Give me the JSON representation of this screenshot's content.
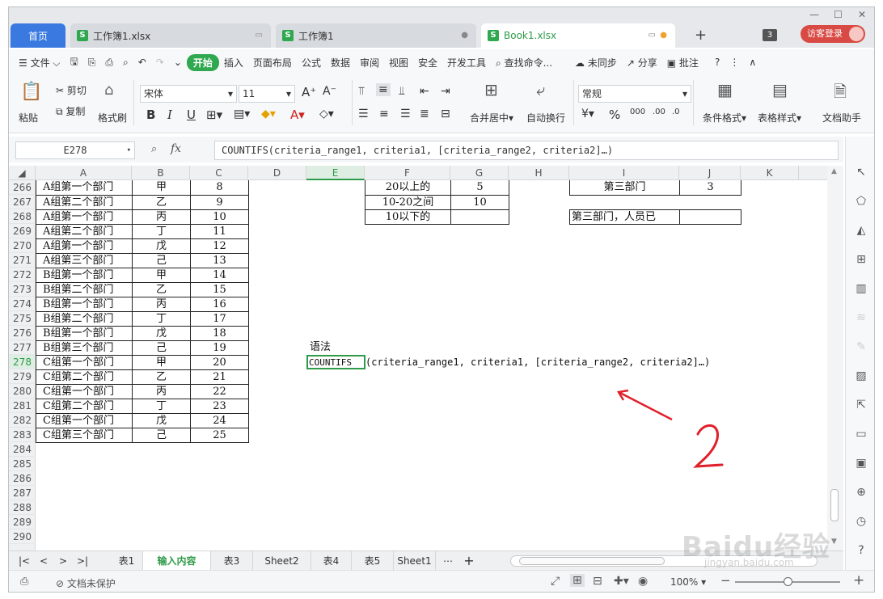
{
  "tabs": {
    "home": "首页",
    "tab1": "工作簿1.xlsx",
    "tab2": "工作簿1",
    "tab3": "Book1.xlsx",
    "count": "3",
    "login": "访客登录"
  },
  "menu": {
    "file": "文件",
    "items": [
      "开始",
      "插入",
      "页面布局",
      "公式",
      "数据",
      "审阅",
      "视图",
      "安全",
      "开发工具"
    ],
    "search": "查找命令...",
    "sync": "未同步",
    "share": "分享",
    "comment": "批注"
  },
  "ribbon": {
    "paste": "粘贴",
    "cut": "剪切",
    "copy": "复制",
    "format_painter": "格式刷",
    "font": "宋体",
    "size": "11",
    "merge": "合并居中",
    "wrap": "自动换行",
    "number_format": "常规",
    "cond_format": "条件格式",
    "table_style": "表格样式",
    "doc_helper": "文档助手"
  },
  "formula": {
    "namebox": "E278",
    "fx": "fx",
    "content": "COUNTIFS(criteria_range1, criteria1, [criteria_range2, criteria2]…)"
  },
  "columns": [
    "A",
    "B",
    "C",
    "D",
    "E",
    "F",
    "G",
    "H",
    "I",
    "J",
    "K"
  ],
  "rows": [
    "266",
    "267",
    "268",
    "269",
    "270",
    "271",
    "272",
    "273",
    "274",
    "275",
    "276",
    "277",
    "278",
    "279",
    "280",
    "281",
    "282",
    "283",
    "284",
    "285",
    "286",
    "287",
    "288",
    "289",
    "290"
  ],
  "table_a": [
    [
      "A组第一个部门",
      "甲",
      "8"
    ],
    [
      "A组第二个部门",
      "乙",
      "9"
    ],
    [
      "A组第一个部门",
      "丙",
      "10"
    ],
    [
      "A组第二个部门",
      "丁",
      "11"
    ],
    [
      "A组第一个部门",
      "戊",
      "12"
    ],
    [
      "A组第三个部门",
      "己",
      "13"
    ],
    [
      "B组第一个部门",
      "甲",
      "14"
    ],
    [
      "B组第二个部门",
      "乙",
      "15"
    ],
    [
      "B组第一个部门",
      "丙",
      "16"
    ],
    [
      "B组第二个部门",
      "丁",
      "17"
    ],
    [
      "B组第一个部门",
      "戊",
      "18"
    ],
    [
      "B组第三个部门",
      "己",
      "19"
    ],
    [
      "C组第一个部门",
      "甲",
      "20"
    ],
    [
      "C组第二个部门",
      "乙",
      "21"
    ],
    [
      "C组第一个部门",
      "丙",
      "22"
    ],
    [
      "C组第二个部门",
      "丁",
      "23"
    ],
    [
      "C组第一个部门",
      "戊",
      "24"
    ],
    [
      "C组第三个部门",
      "己",
      "25"
    ]
  ],
  "table_f": [
    [
      "20以上的",
      "5"
    ],
    [
      "10-20之间",
      "10"
    ],
    [
      "10以下的",
      ""
    ]
  ],
  "table_i": {
    "r1_label": "第三部门",
    "r1_value": "3",
    "r2_label": "第三部门，人员已",
    "r2_value": ""
  },
  "syntax_label": "语法",
  "syntax_cell": "COUNTIFS",
  "syntax_rest": "(criteria_range1, criteria1, [criteria_range2, criteria2]…)",
  "annotation_number": "2",
  "sheets": [
    "表1",
    "输入内容",
    "表3",
    "Sheet2",
    "表4",
    "表5",
    "Sheet1"
  ],
  "active_sheet": "输入内容",
  "status": {
    "protect": "文档未保护",
    "zoom": "100%"
  },
  "watermark": {
    "brand": "Baidu经验",
    "url": "jingyan.baidu.com"
  },
  "colors": {
    "accent": "#2e9b48",
    "home_tab": "#3a7ae0",
    "login": "#d84a43",
    "arrow": "#e0202a"
  }
}
